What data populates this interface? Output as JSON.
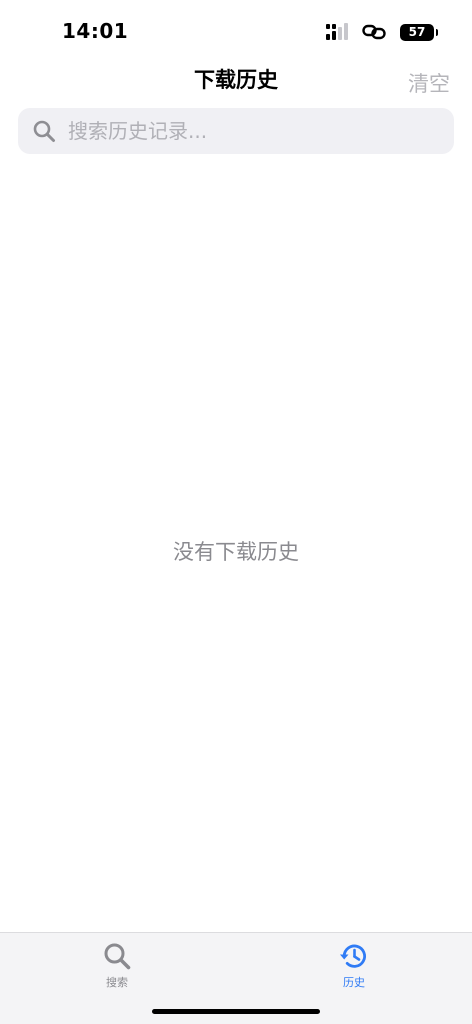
{
  "status_bar": {
    "time": "14:01",
    "battery": "57"
  },
  "nav": {
    "title": "下载历史",
    "clear_label": "清空"
  },
  "search": {
    "placeholder": "搜索历史记录...",
    "value": ""
  },
  "empty_state": {
    "message": "没有下载历史"
  },
  "tab_bar": {
    "tabs": [
      {
        "label": "搜索",
        "icon": "search-icon",
        "active": false
      },
      {
        "label": "历史",
        "icon": "history-icon",
        "active": true
      }
    ]
  },
  "colors": {
    "accent": "#2f7bf5",
    "inactive": "#8a8a8f",
    "clear_disabled": "#b5b5ba",
    "search_bg": "#f0f0f4",
    "tab_bar_bg": "#f4f4f6"
  }
}
